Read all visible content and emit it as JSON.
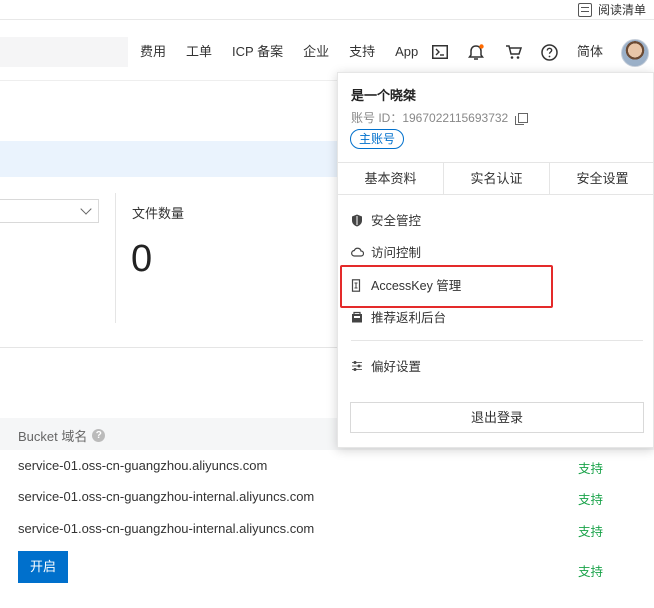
{
  "top_strip": {
    "reading_list": "阅读清单"
  },
  "header": {
    "nav": [
      "费用",
      "工单",
      "ICP 备案",
      "企业",
      "支持",
      "App"
    ],
    "simplified": "简体",
    "icons": [
      "terminal-icon",
      "bell-icon",
      "cart-icon",
      "help-icon"
    ],
    "notification_color": "#ff6a00"
  },
  "background": {
    "file_count_label": "文件数量",
    "file_count": "0",
    "bucket_domain_header": "Bucket 域名",
    "rows": [
      {
        "domain": "service-01.oss-cn-guangzhou.aliyuncs.com",
        "status": "支持"
      },
      {
        "domain": "service-01.oss-cn-guangzhou-internal.aliyuncs.com",
        "status": "支持"
      },
      {
        "domain": "service-01.oss-cn-guangzhou-internal.aliyuncs.com",
        "status": "支持"
      }
    ],
    "last_status": "支持",
    "open_button": "开启",
    "help_glyph": "?"
  },
  "user_menu": {
    "name": "是一个晓桀",
    "account_id": "账号 ID：1967022115693732",
    "badge": "主账号",
    "tabs": [
      "基本资料",
      "实名认证",
      "安全设置"
    ],
    "items": [
      {
        "label": "安全管控",
        "icon": "shield-icon"
      },
      {
        "label": "访问控制",
        "icon": "cloud-icon"
      },
      {
        "label": "AccessKey 管理",
        "icon": "key-icon"
      },
      {
        "label": "推荐返利后台",
        "icon": "gift-icon"
      },
      {
        "label": "偏好设置",
        "icon": "sliders-icon"
      }
    ],
    "logout": "退出登录"
  },
  "colors": {
    "accent": "#0070cc",
    "success": "#1aa34a",
    "highlight": "#e42a2a"
  }
}
